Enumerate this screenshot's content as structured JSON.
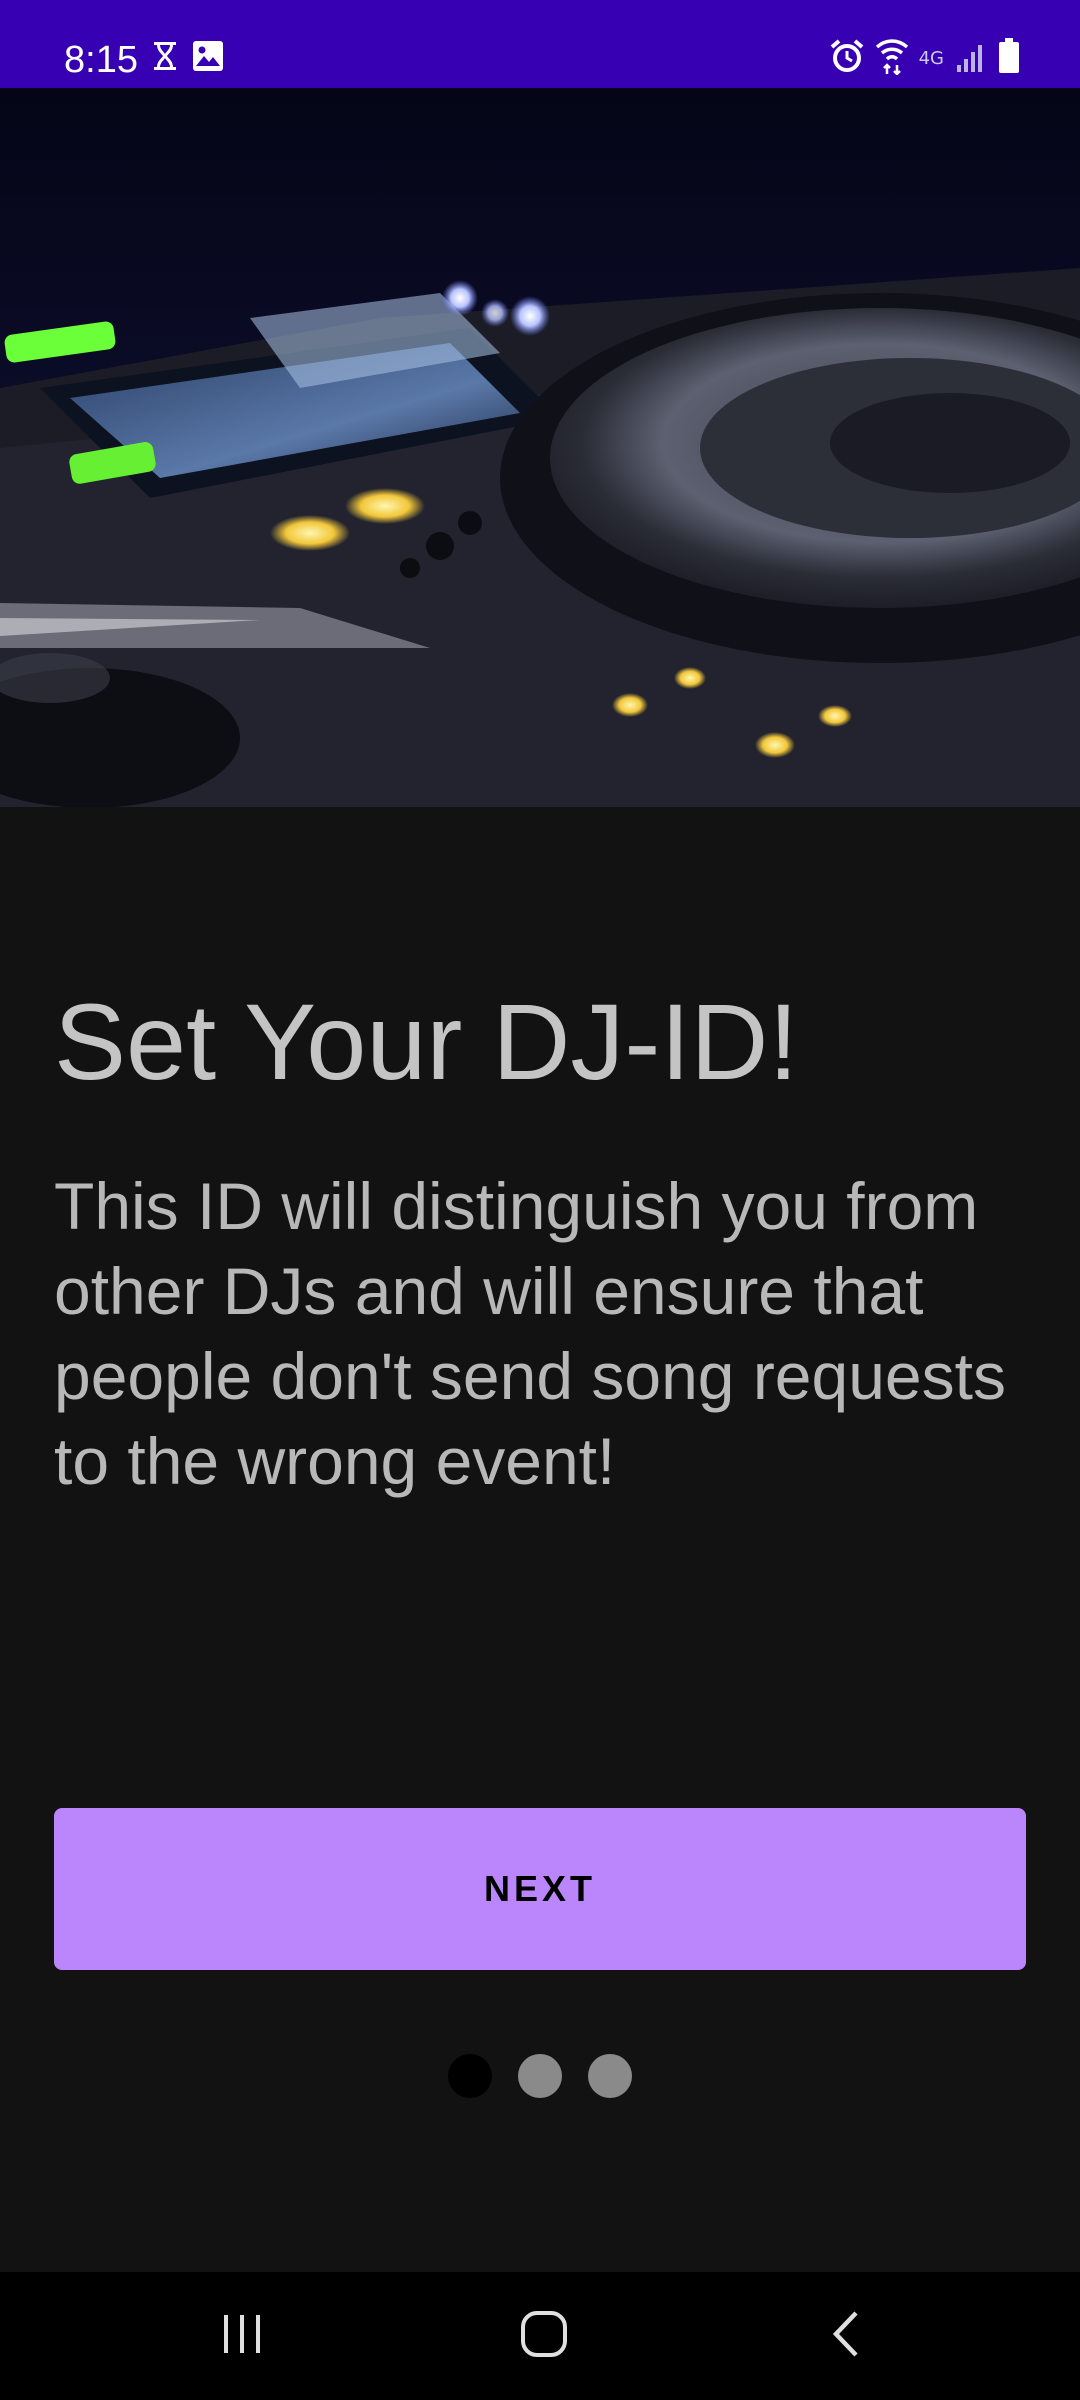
{
  "status_bar": {
    "time": "8:15",
    "left_icons": [
      "hourglass-icon",
      "image-icon"
    ],
    "network_label": "4G",
    "right_icons": [
      "alarm-icon",
      "wifi-icon",
      "signal-icon",
      "battery-icon"
    ],
    "background_color": "#3700B3"
  },
  "hero": {
    "image_subject": "DJ turntable / mixer controller"
  },
  "onboarding": {
    "title": "Set Your DJ-ID!",
    "description": "This ID will distinguish you from other DJs and will ensure that people don't send song requests to the wrong event!",
    "next_label": "NEXT",
    "page_indicator": {
      "total": 3,
      "current": 1
    }
  },
  "nav_bar": {
    "buttons": [
      "recents-icon",
      "home-icon",
      "back-icon"
    ]
  },
  "colors": {
    "accent": "#BB86FC",
    "background": "#121212",
    "text": "#C4C4C4"
  }
}
